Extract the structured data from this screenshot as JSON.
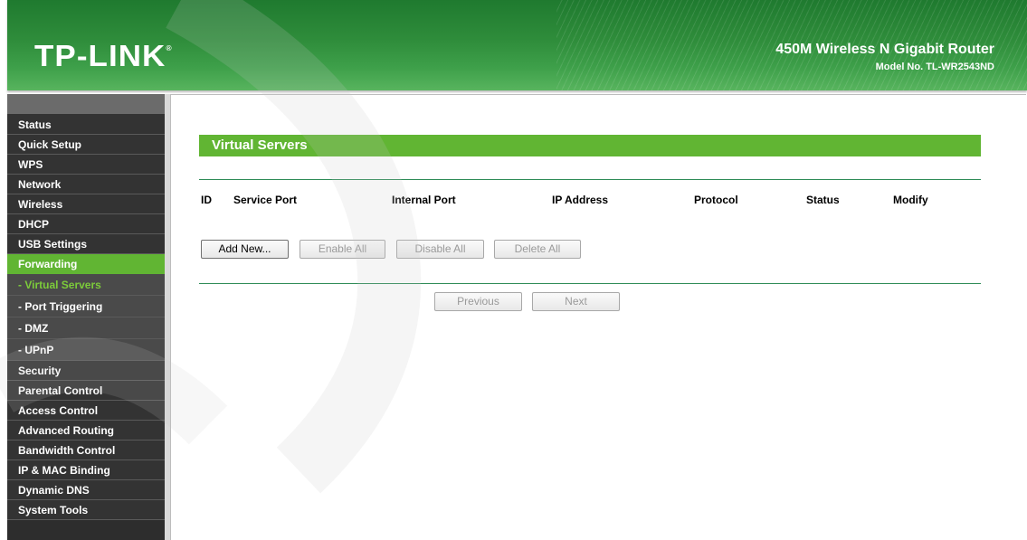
{
  "header": {
    "logo": "TP-LINK",
    "logo_mark": "®",
    "product_title": "450M Wireless N Gigabit Router",
    "model_number": "Model No. TL-WR2543ND",
    "accent": "#61b533",
    "header_green": "#2f8d3b"
  },
  "sidebar": {
    "items": [
      {
        "label": "Status"
      },
      {
        "label": "Quick Setup"
      },
      {
        "label": "WPS"
      },
      {
        "label": "Network"
      },
      {
        "label": "Wireless"
      },
      {
        "label": "DHCP"
      },
      {
        "label": "USB Settings"
      },
      {
        "label": "Forwarding"
      },
      {
        "label": "- Virtual Servers"
      },
      {
        "label": "- Port Triggering"
      },
      {
        "label": "- DMZ"
      },
      {
        "label": "- UPnP"
      },
      {
        "label": "Security"
      },
      {
        "label": "Parental Control"
      },
      {
        "label": "Access Control"
      },
      {
        "label": "Advanced Routing"
      },
      {
        "label": "Bandwidth Control"
      },
      {
        "label": "IP & MAC Binding"
      },
      {
        "label": "Dynamic DNS"
      },
      {
        "label": "System Tools"
      }
    ],
    "active": "Forwarding",
    "current_sub": "- Virtual Servers"
  },
  "main": {
    "section_title": "Virtual Servers",
    "table_headers": [
      "ID",
      "Service Port",
      "Internal Port",
      "IP Address",
      "Protocol",
      "Status",
      "Modify"
    ],
    "buttons": {
      "add_new": "Add New...",
      "enable_all": "Enable All",
      "disable_all": "Disable All",
      "delete_all": "Delete All",
      "previous": "Previous",
      "next": "Next"
    }
  }
}
